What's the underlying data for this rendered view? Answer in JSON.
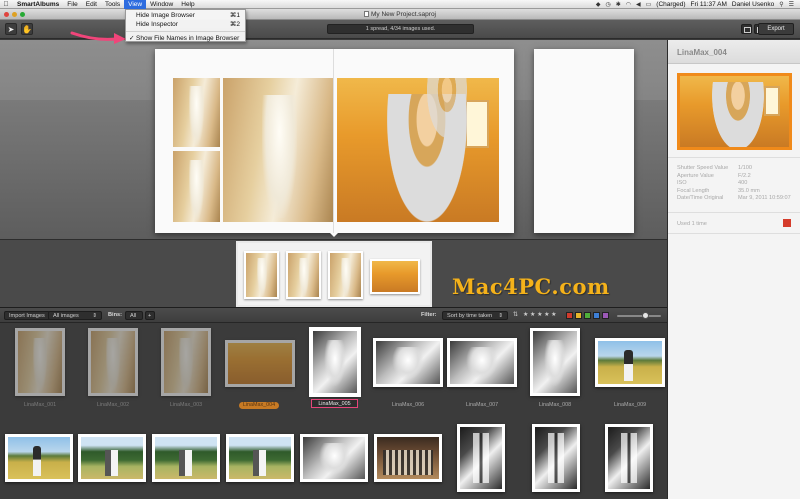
{
  "menubar": {
    "apple": "",
    "app_name": "SmartAlbums",
    "menus": [
      "File",
      "Edit",
      "Tools",
      "View",
      "Window",
      "Help"
    ],
    "active_menu": "View",
    "battery": "(Charged)",
    "clock": "Fri 11:37 AM",
    "user": "Daniel Usenko"
  },
  "window": {
    "title": "My New Project.saproj"
  },
  "toolbar": {
    "status": "1 spread, 4/34 images used.",
    "export_label": "Export"
  },
  "view_menu": {
    "items": [
      {
        "label": "Hide Image Browser",
        "shortcut": "⌘1"
      },
      {
        "label": "Hide Inspector",
        "shortcut": "⌘2"
      },
      {
        "label": "Show File Names in Image Browser",
        "checked": "✓"
      }
    ]
  },
  "inspector": {
    "title": "LinaMax_004",
    "metadata": [
      {
        "key": "Shutter Speed Value",
        "value": "1/100"
      },
      {
        "key": "Aperture Value",
        "value": "F/2.2"
      },
      {
        "key": "ISO",
        "value": "400"
      },
      {
        "key": "Focal Length",
        "value": "35.0 mm"
      },
      {
        "key": "Date/Time Original",
        "value": "Mar 9, 2011 10:59:07"
      }
    ],
    "used_text": "Used 1 time",
    "used_color": "#d53c2b"
  },
  "watermark": "Mac4PC.com",
  "browser": {
    "import_label": "Import Images",
    "source_label": "All images",
    "bins_label": "Bins:",
    "bins_value": "All",
    "add_bin": "+",
    "filter_label": "Filter:",
    "sort_label": "Sort by time taken",
    "star_rating": "★ ★ ★ ★ ★",
    "color_labels": [
      "#d03a2c",
      "#e7b62b",
      "#4fae3a",
      "#3d7fd6",
      "#9b59b6",
      "#9a9a9a"
    ],
    "row1": [
      {
        "label": "LinaMax_001",
        "style": "dim"
      },
      {
        "label": "LinaMax_002",
        "style": "dim"
      },
      {
        "label": "LinaMax_003",
        "style": "dim"
      },
      {
        "label": "LinaMax_004",
        "style": "orange"
      },
      {
        "label": "LinaMax_005",
        "style": "boxed"
      },
      {
        "label": "LinaMax_006",
        "style": "normal"
      },
      {
        "label": "LinaMax_007",
        "style": "normal"
      },
      {
        "label": "LinaMax_008",
        "style": "normal"
      },
      {
        "label": "LinaMax_009",
        "style": "normal"
      }
    ]
  }
}
